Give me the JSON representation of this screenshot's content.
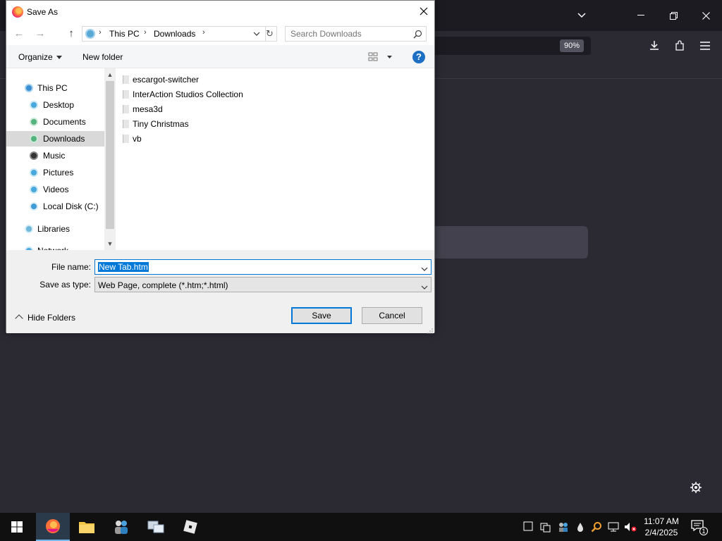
{
  "browser": {
    "zoom": "90%"
  },
  "dialog": {
    "title": "Save As",
    "address": {
      "crumbs": [
        "This PC",
        "Downloads"
      ]
    },
    "search_placeholder": "Search Downloads",
    "commands": {
      "organize": "Organize",
      "new_folder": "New folder"
    },
    "nav_items": [
      {
        "label": "This PC",
        "icon": "pc-icon"
      },
      {
        "label": "Desktop",
        "icon": "desktop-icon"
      },
      {
        "label": "Documents",
        "icon": "documents-icon"
      },
      {
        "label": "Downloads",
        "icon": "downloads-icon"
      },
      {
        "label": "Music",
        "icon": "music-icon"
      },
      {
        "label": "Pictures",
        "icon": "pictures-icon"
      },
      {
        "label": "Videos",
        "icon": "videos-icon"
      },
      {
        "label": "Local Disk (C:)",
        "icon": "disk-icon"
      },
      {
        "label": "Libraries",
        "icon": "libraries-icon"
      },
      {
        "label": "Network",
        "icon": "network-icon"
      }
    ],
    "files": [
      {
        "name": "escargot-switcher"
      },
      {
        "name": "InterAction Studios Collection"
      },
      {
        "name": "mesa3d"
      },
      {
        "name": "Tiny Christmas"
      },
      {
        "name": "vb"
      }
    ],
    "file_name_label": "File name:",
    "file_name_value": "New Tab.htm",
    "save_type_label": "Save as type:",
    "save_type_value": "Web Page, complete (*.htm;*.html)",
    "hide_folders": "Hide Folders",
    "save_button": "Save",
    "cancel_button": "Cancel"
  },
  "taskbar": {
    "time": "11:07 AM",
    "date": "2/4/2025",
    "notification_count": "1"
  }
}
